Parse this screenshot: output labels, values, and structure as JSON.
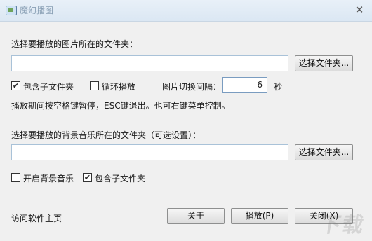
{
  "window": {
    "title": "魔幻播图",
    "close_glyph": "✕"
  },
  "image_folder": {
    "label": "选择要播放的图片所在的文件夹：",
    "value": "",
    "browse_label": "选择文件夹..."
  },
  "image_options": {
    "include_subfolders": {
      "label": "包含子文件夹",
      "checked": true
    },
    "loop_play": {
      "label": "循环播放",
      "checked": false
    },
    "interval_label": "图片切换间隔：",
    "interval_value": "6",
    "interval_unit": "秒"
  },
  "hint": "播放期间按空格键暂停，ESC键退出。也可右键菜单控制。",
  "music_folder": {
    "label": "选择要播放的背景音乐所在的文件夹（可选设置）：",
    "value": "",
    "browse_label": "选择文件夹..."
  },
  "music_options": {
    "enable_music": {
      "label": "开启背景音乐",
      "checked": false
    },
    "include_subfolders": {
      "label": "包含子文件夹",
      "checked": true
    }
  },
  "footer": {
    "homepage_link": "访问软件主页",
    "about_label": "关于",
    "play_label": "播放(P)",
    "close_label": "关闭(X)"
  },
  "check_glyph": "✔"
}
